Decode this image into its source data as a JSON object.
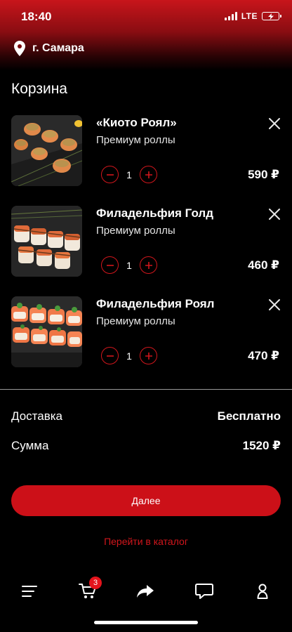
{
  "status_bar": {
    "time": "18:40",
    "network": "LTE"
  },
  "location": {
    "city": "г. Самара",
    "icon": "map-pin-icon"
  },
  "page_title": "Корзина",
  "cart": {
    "items": [
      {
        "name": "«Киото Роял»",
        "category": "Премиум роллы",
        "quantity": "1",
        "price": "590 ₽",
        "image": "kioto-royal-photo"
      },
      {
        "name": "Филадельфия Голд",
        "category": "Премиум роллы",
        "quantity": "1",
        "price": "460 ₽",
        "image": "philadelphia-gold-photo"
      },
      {
        "name": "Филадельфия Роял",
        "category": "Премиум роллы",
        "quantity": "1",
        "price": "470 ₽",
        "image": "philadelphia-royal-photo"
      }
    ]
  },
  "summary": {
    "delivery_label": "Доставка",
    "delivery_value": "Бесплатно",
    "total_label": "Сумма",
    "total_value": "1520 ₽"
  },
  "actions": {
    "next_label": "Далее",
    "catalog_link": "Перейти в каталог"
  },
  "tabbar": {
    "icons": [
      "menu-icon",
      "cart-icon",
      "share-icon",
      "chat-icon",
      "profile-icon"
    ],
    "cart_badge": "3"
  },
  "colors": {
    "accent": "#cc1018",
    "background": "#000000",
    "header_gradient_top": "#c8151b"
  }
}
